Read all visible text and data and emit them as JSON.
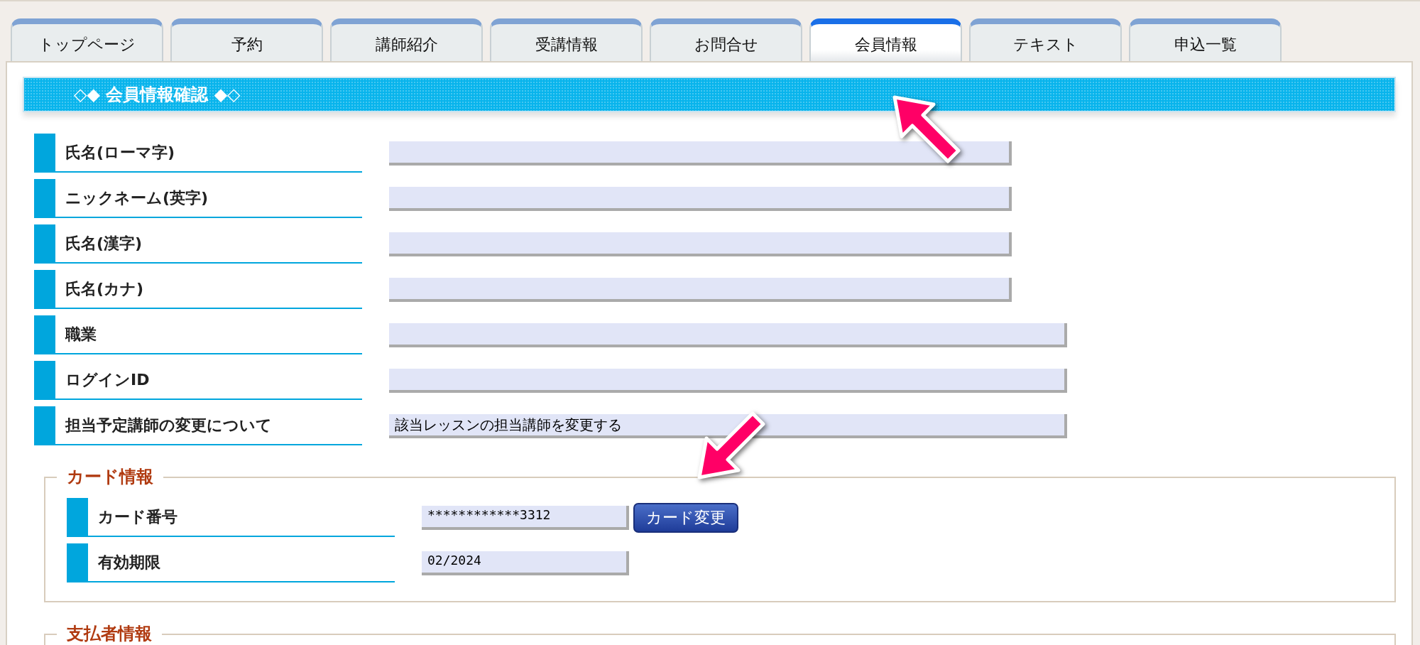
{
  "tabs": [
    {
      "label": "トップページ",
      "selected": false
    },
    {
      "label": "予約",
      "selected": false
    },
    {
      "label": "講師紹介",
      "selected": false
    },
    {
      "label": "受講情報",
      "selected": false
    },
    {
      "label": "お問合せ",
      "selected": false
    },
    {
      "label": "会員情報",
      "selected": true
    },
    {
      "label": "テキスト",
      "selected": false
    },
    {
      "label": "申込一覧",
      "selected": false
    }
  ],
  "panel": {
    "title": "◇◆ 会員情報確認 ◆◇",
    "fields": [
      {
        "label": "氏名(ローマ字)",
        "kind": "short"
      },
      {
        "label": "ニックネーム(英字)",
        "kind": "short"
      },
      {
        "label": "氏名(漢字)",
        "kind": "short"
      },
      {
        "label": "氏名(カナ)",
        "kind": "short"
      },
      {
        "label": "職業",
        "kind": "long"
      },
      {
        "label": "ログインID",
        "kind": "long"
      },
      {
        "label": "担当予定講師の変更について",
        "kind": "long",
        "value": "該当レッスンの担当講師を変更する"
      }
    ],
    "sections": [
      {
        "legend": "カード情報",
        "fields": [
          {
            "label": "カード番号",
            "value": "************3312",
            "button": "カード変更"
          },
          {
            "label": "有効期限",
            "value": "02/2024"
          }
        ]
      },
      {
        "legend": "支払者情報"
      }
    ]
  }
}
